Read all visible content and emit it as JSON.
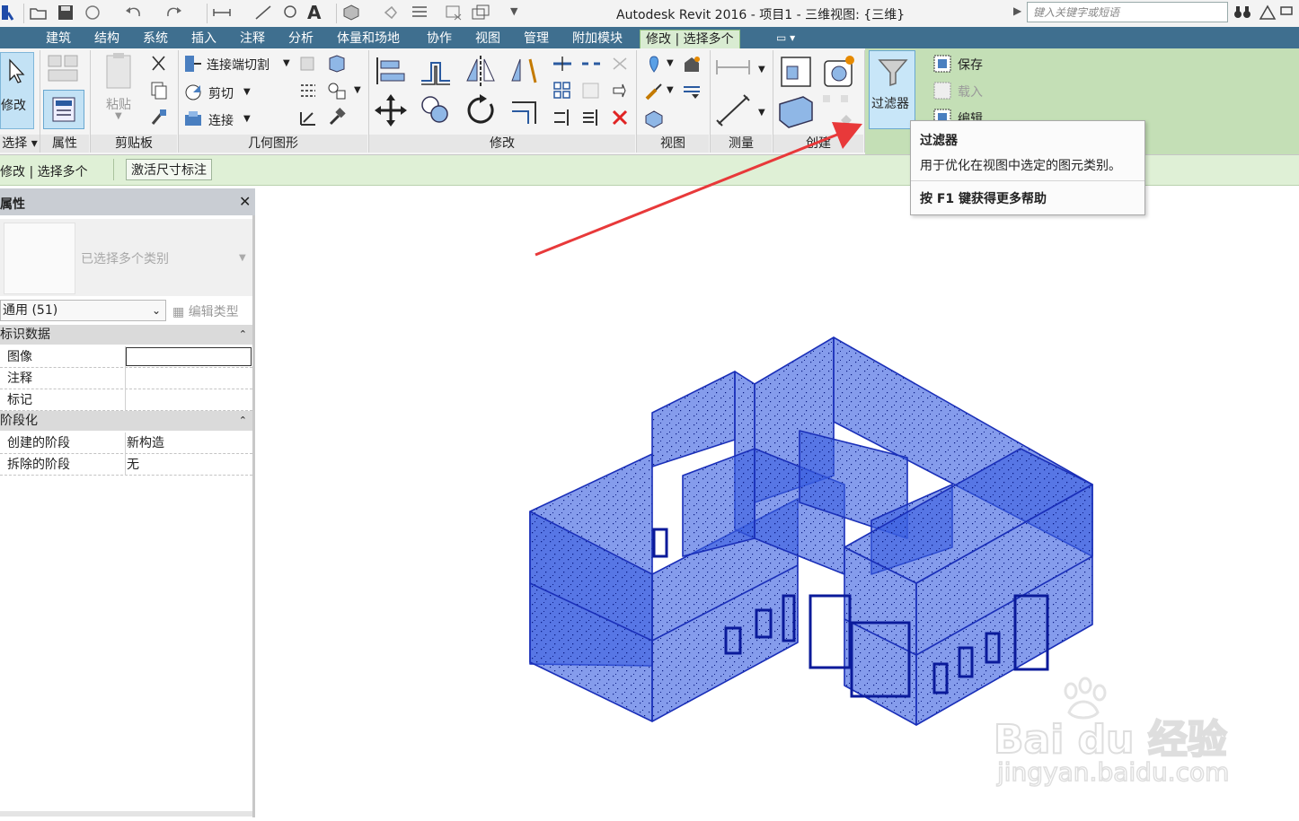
{
  "titlebar": {
    "title": "Autodesk Revit 2016 -    项目1 - 三维视图: {三维}",
    "search_placeholder": "键入关键字或短语"
  },
  "tabs": [
    "建筑",
    "结构",
    "系统",
    "插入",
    "注释",
    "分析",
    "体量和场地",
    "协作",
    "视图",
    "管理",
    "附加模块",
    "修改 | 选择多个"
  ],
  "ribbon": {
    "modify_label": "修改",
    "properties_label": "属性",
    "paste_label": "粘贴",
    "join_cut_label": "连接端切割",
    "cut_label": "剪切",
    "join_label": "连接",
    "filter_label": "过滤器",
    "save_label": "保存",
    "load_label": "载入",
    "edit_label": "编辑",
    "panels": {
      "select": "选择",
      "properties": "属性",
      "clipboard": "剪贴板",
      "geometry": "几何图形",
      "modify": "修改",
      "view": "视图",
      "measure": "测量",
      "create": "创建"
    }
  },
  "options_bar": {
    "context": "修改 | 选择多个",
    "activate_dimensions": "激活尺寸标注"
  },
  "properties": {
    "title": "属性",
    "type_label": "已选择多个类别",
    "filter_value": "通用 (51)",
    "edit_type": "编辑类型",
    "groups": [
      {
        "name": "标识数据",
        "rows": [
          [
            "图像",
            ""
          ],
          [
            "注释",
            ""
          ],
          [
            "标记",
            ""
          ]
        ]
      },
      {
        "name": "阶段化",
        "rows": [
          [
            "创建的阶段",
            "新构造"
          ],
          [
            "拆除的阶段",
            "无"
          ]
        ]
      }
    ]
  },
  "tooltip": {
    "title": "过滤器",
    "description": "用于优化在视图中选定的图元类别。",
    "help": "按 F1 键获得更多帮助"
  },
  "watermark": {
    "brand": "Bai du 经验",
    "url": "jingyan.baidu.com"
  },
  "colors": {
    "ribbon_tab_bg": "#3f6f8f",
    "contextual_green": "#c4dfb6",
    "selection_blue": "#2f55e0",
    "arrow_red": "#e8393a"
  }
}
